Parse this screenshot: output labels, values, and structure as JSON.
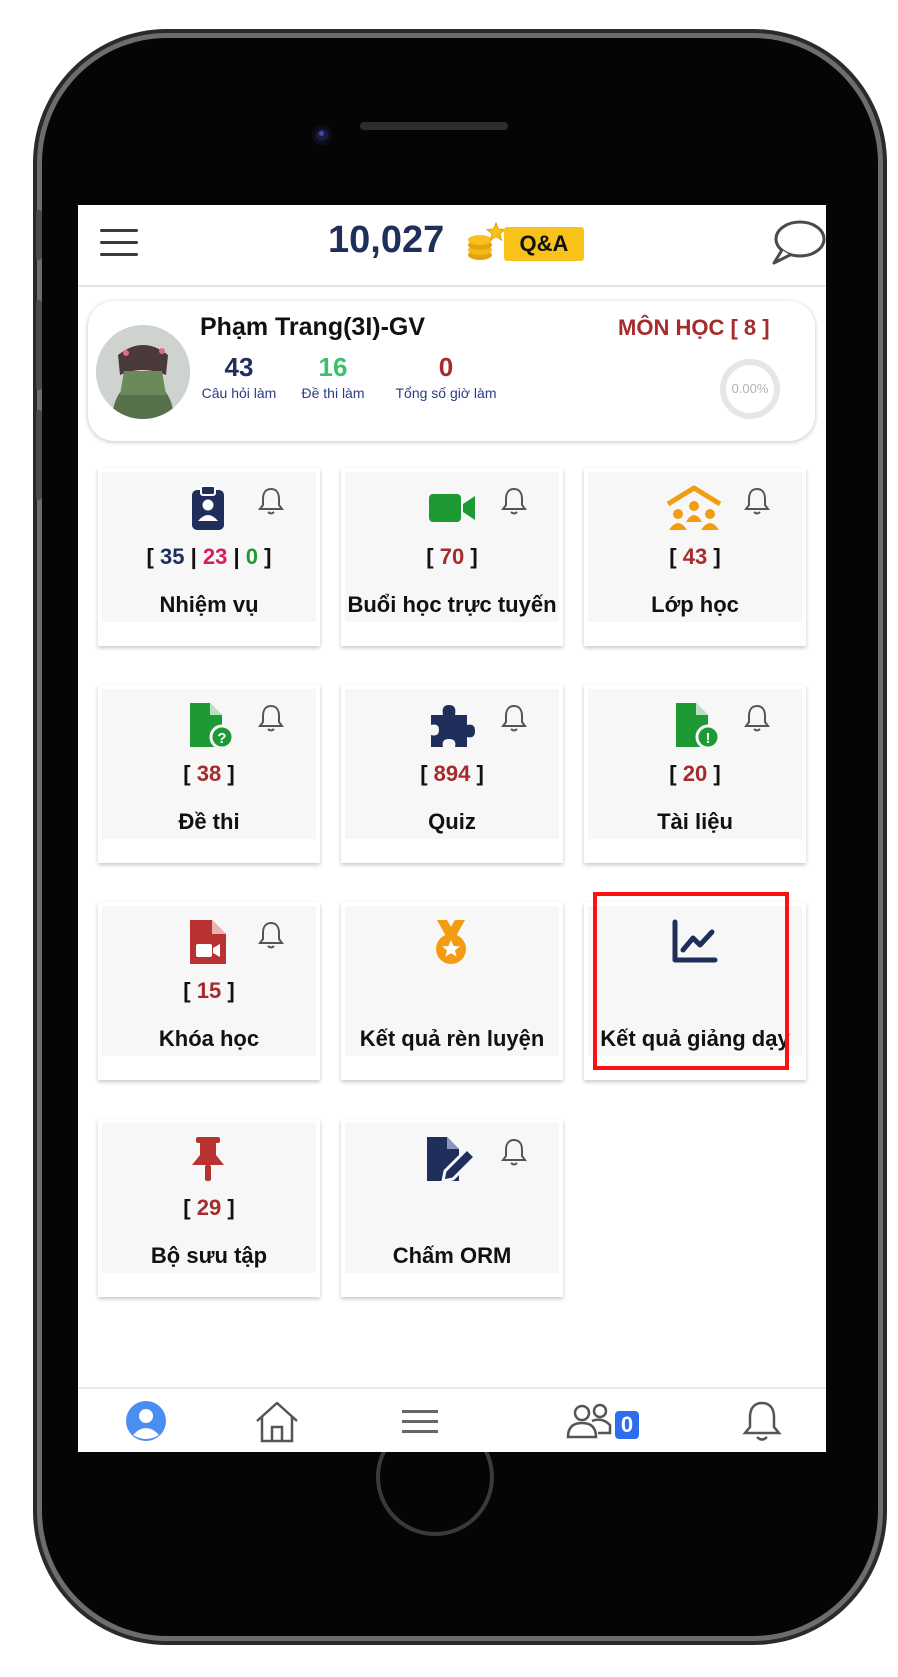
{
  "header": {
    "points": "10,027",
    "qa_label": "Q&A",
    "icons": [
      "menu-icon",
      "coins-icon",
      "chat-icon"
    ]
  },
  "profile": {
    "name": "Phạm Trang(3I)-GV",
    "subjects": "MÔN HỌC [ 8 ]",
    "progress": "0.00%",
    "stats": [
      {
        "value": "43",
        "label": "Câu hỏi làm",
        "color": "#1f2e5a"
      },
      {
        "value": "16",
        "label": "Đề thi làm",
        "color": "#3cc06a"
      },
      {
        "value": "0",
        "label": "Tổng số giờ làm",
        "color": "#a62b2b"
      }
    ]
  },
  "tiles": {
    "nhiem_vu": {
      "label": "Nhiệm vụ",
      "c1": "35",
      "c2": "23",
      "c3": "0",
      "icon": "clipboard-user-icon"
    },
    "buoi_hoc": {
      "label": "Buổi học trực tuyến",
      "count": "70",
      "icon": "video-camera-icon"
    },
    "lop_hoc": {
      "label": "Lớp học",
      "count": "43",
      "icon": "classroom-icon"
    },
    "de_thi": {
      "label": "Đề thi",
      "count": "38",
      "icon": "file-question-icon"
    },
    "quiz": {
      "label": "Quiz",
      "count": "894",
      "icon": "puzzle-icon"
    },
    "tai_lieu": {
      "label": "Tài liệu",
      "count": "20",
      "icon": "file-alert-icon"
    },
    "khoa_hoc": {
      "label": "Khóa học",
      "count": "15",
      "icon": "file-video-icon"
    },
    "ket_qua_ren_luyen": {
      "label": "Kết quả rèn luyện",
      "icon": "medal-icon"
    },
    "ket_qua_giang_day": {
      "label": "Kết quả giảng dạy",
      "icon": "line-chart-icon"
    },
    "bo_suu_tap": {
      "label": "Bộ sưu tập",
      "count": "29",
      "icon": "pin-icon"
    },
    "cham_orm": {
      "label": "Chấm ORM",
      "icon": "file-pen-icon"
    }
  },
  "bottom_nav": {
    "items": [
      "profile-icon",
      "home-icon",
      "menu-icon",
      "users-icon",
      "bell-icon"
    ],
    "groups_badge": "0",
    "active_color": "#4a8ef0"
  },
  "colors": {
    "brand_navy": "#1f2e5a",
    "accent_red": "#a62b2b",
    "green": "#1e9a34",
    "orange": "#f39c12",
    "qa_yellow": "#f8c21a",
    "highlight": "#ff1010"
  }
}
